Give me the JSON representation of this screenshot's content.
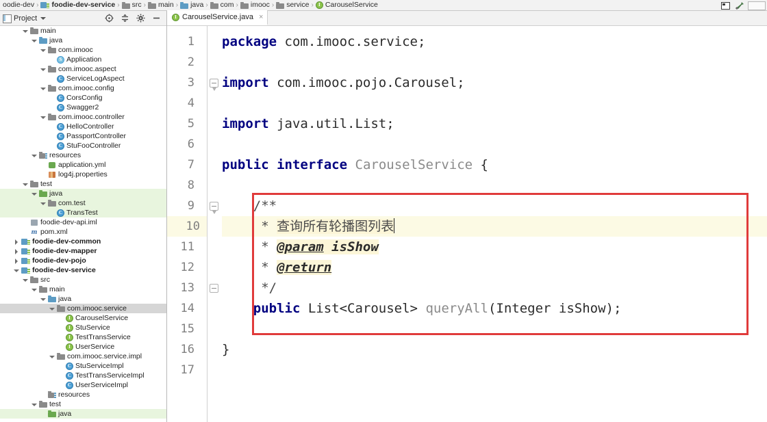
{
  "navbar": {
    "crumbs": [
      {
        "label": "oodie-dev",
        "icon": "none",
        "bold": false
      },
      {
        "label": "foodie-dev-service",
        "icon": "module-icon",
        "bold": true
      },
      {
        "label": "src",
        "icon": "folder-icon",
        "bold": false
      },
      {
        "label": "main",
        "icon": "folder-icon",
        "bold": false
      },
      {
        "label": "java",
        "icon": "source-folder-icon",
        "bold": false
      },
      {
        "label": "com",
        "icon": "folder-icon",
        "bold": false
      },
      {
        "label": "imooc",
        "icon": "folder-icon",
        "bold": false
      },
      {
        "label": "service",
        "icon": "folder-icon",
        "bold": false
      },
      {
        "label": "CarouselService",
        "icon": "interface-icon",
        "bold": false
      }
    ],
    "separator": "›",
    "right_icons": [
      "layout-window-icon",
      "build-hammer-icon"
    ]
  },
  "project_panel": {
    "title": "Project",
    "toolbar_icons": [
      "locate-target-icon",
      "collapse-all-icon",
      "settings-gear-icon",
      "hide-minimize-icon"
    ],
    "tree": [
      {
        "label": "main",
        "indent": 2,
        "icon": "folder-icon",
        "arrow": "down",
        "bold": false,
        "state": "normal"
      },
      {
        "label": "java",
        "indent": 3,
        "icon": "source-folder-icon",
        "arrow": "down",
        "bold": false,
        "state": "normal"
      },
      {
        "label": "com.imooc",
        "indent": 4,
        "icon": "folder-icon",
        "arrow": "down",
        "bold": false,
        "state": "normal"
      },
      {
        "label": "Application",
        "indent": 5,
        "icon": "spring-class-icon",
        "arrow": "none",
        "bold": false,
        "state": "normal"
      },
      {
        "label": "com.imooc.aspect",
        "indent": 4,
        "icon": "folder-icon",
        "arrow": "down",
        "bold": false,
        "state": "normal"
      },
      {
        "label": "ServiceLogAspect",
        "indent": 5,
        "icon": "class-icon",
        "arrow": "none",
        "bold": false,
        "state": "normal"
      },
      {
        "label": "com.imooc.config",
        "indent": 4,
        "icon": "folder-icon",
        "arrow": "down",
        "bold": false,
        "state": "normal"
      },
      {
        "label": "CorsConfig",
        "indent": 5,
        "icon": "class-icon",
        "arrow": "none",
        "bold": false,
        "state": "normal"
      },
      {
        "label": "Swagger2",
        "indent": 5,
        "icon": "class-icon",
        "arrow": "none",
        "bold": false,
        "state": "normal"
      },
      {
        "label": "com.imooc.controller",
        "indent": 4,
        "icon": "folder-icon",
        "arrow": "down",
        "bold": false,
        "state": "normal"
      },
      {
        "label": "HelloController",
        "indent": 5,
        "icon": "class-icon",
        "arrow": "none",
        "bold": false,
        "state": "normal"
      },
      {
        "label": "PassportController",
        "indent": 5,
        "icon": "class-icon",
        "arrow": "none",
        "bold": false,
        "state": "normal"
      },
      {
        "label": "StuFooController",
        "indent": 5,
        "icon": "class-icon",
        "arrow": "none",
        "bold": false,
        "state": "normal"
      },
      {
        "label": "resources",
        "indent": 3,
        "icon": "resources-folder-icon",
        "arrow": "down",
        "bold": false,
        "state": "normal"
      },
      {
        "label": "application.yml",
        "indent": 4,
        "icon": "yaml-file-icon",
        "arrow": "none",
        "bold": false,
        "state": "normal"
      },
      {
        "label": "log4j.properties",
        "indent": 4,
        "icon": "properties-file-icon",
        "arrow": "none",
        "bold": false,
        "state": "normal"
      },
      {
        "label": "test",
        "indent": 2,
        "icon": "folder-icon",
        "arrow": "down",
        "bold": false,
        "state": "normal"
      },
      {
        "label": "java",
        "indent": 3,
        "icon": "test-source-folder-icon",
        "arrow": "down",
        "bold": false,
        "state": "testsrc"
      },
      {
        "label": "com.test",
        "indent": 4,
        "icon": "folder-icon",
        "arrow": "down",
        "bold": false,
        "state": "testsrc"
      },
      {
        "label": "TransTest",
        "indent": 5,
        "icon": "class-icon",
        "arrow": "none",
        "bold": false,
        "state": "testsrc"
      },
      {
        "label": "foodie-dev-api.iml",
        "indent": 2,
        "icon": "iml-file-icon",
        "arrow": "none",
        "bold": false,
        "state": "normal"
      },
      {
        "label": "pom.xml",
        "indent": 2,
        "icon": "maven-file-icon",
        "arrow": "none",
        "bold": false,
        "state": "normal"
      },
      {
        "label": "foodie-dev-common",
        "indent": 1,
        "icon": "module-icon",
        "arrow": "right",
        "bold": true,
        "state": "normal"
      },
      {
        "label": "foodie-dev-mapper",
        "indent": 1,
        "icon": "module-icon",
        "arrow": "right",
        "bold": true,
        "state": "normal"
      },
      {
        "label": "foodie-dev-pojo",
        "indent": 1,
        "icon": "module-icon",
        "arrow": "right",
        "bold": true,
        "state": "normal"
      },
      {
        "label": "foodie-dev-service",
        "indent": 1,
        "icon": "module-icon",
        "arrow": "down",
        "bold": true,
        "state": "normal"
      },
      {
        "label": "src",
        "indent": 2,
        "icon": "folder-icon",
        "arrow": "down",
        "bold": false,
        "state": "normal"
      },
      {
        "label": "main",
        "indent": 3,
        "icon": "folder-icon",
        "arrow": "down",
        "bold": false,
        "state": "normal"
      },
      {
        "label": "java",
        "indent": 4,
        "icon": "source-folder-icon",
        "arrow": "down",
        "bold": false,
        "state": "normal"
      },
      {
        "label": "com.imooc.service",
        "indent": 5,
        "icon": "folder-icon",
        "arrow": "down",
        "bold": false,
        "state": "selected"
      },
      {
        "label": "CarouselService",
        "indent": 6,
        "icon": "interface-icon",
        "arrow": "none",
        "bold": false,
        "state": "normal"
      },
      {
        "label": "StuService",
        "indent": 6,
        "icon": "interface-icon",
        "arrow": "none",
        "bold": false,
        "state": "normal"
      },
      {
        "label": "TestTransService",
        "indent": 6,
        "icon": "interface-icon",
        "arrow": "none",
        "bold": false,
        "state": "normal"
      },
      {
        "label": "UserService",
        "indent": 6,
        "icon": "interface-icon",
        "arrow": "none",
        "bold": false,
        "state": "normal"
      },
      {
        "label": "com.imooc.service.impl",
        "indent": 5,
        "icon": "folder-icon",
        "arrow": "down",
        "bold": false,
        "state": "normal"
      },
      {
        "label": "StuServiceImpl",
        "indent": 6,
        "icon": "class-icon",
        "arrow": "none",
        "bold": false,
        "state": "normal"
      },
      {
        "label": "TestTransServiceImpl",
        "indent": 6,
        "icon": "class-icon",
        "arrow": "none",
        "bold": false,
        "state": "normal"
      },
      {
        "label": "UserServiceImpl",
        "indent": 6,
        "icon": "class-icon",
        "arrow": "none",
        "bold": false,
        "state": "normal"
      },
      {
        "label": "resources",
        "indent": 4,
        "icon": "resources-folder-icon",
        "arrow": "none",
        "bold": false,
        "state": "normal"
      },
      {
        "label": "test",
        "indent": 3,
        "icon": "folder-icon",
        "arrow": "down",
        "bold": false,
        "state": "normal"
      },
      {
        "label": "java",
        "indent": 4,
        "icon": "test-source-folder-icon",
        "arrow": "none",
        "bold": false,
        "state": "testsrc"
      }
    ]
  },
  "editor": {
    "tabs": [
      {
        "label": "CarouselService.java",
        "icon": "interface-icon",
        "close": "×",
        "active": true
      }
    ],
    "current_line": 10,
    "lines": [
      {
        "n": 1,
        "tokens": [
          {
            "t": "package",
            "c": "kw"
          },
          {
            "t": " com.imooc.service;",
            "c": "plain"
          }
        ]
      },
      {
        "n": 2,
        "tokens": []
      },
      {
        "n": 3,
        "tokens": [
          {
            "t": "import",
            "c": "kw"
          },
          {
            "t": " com.imooc.pojo.Carousel;",
            "c": "plain"
          }
        ]
      },
      {
        "n": 4,
        "tokens": []
      },
      {
        "n": 5,
        "tokens": [
          {
            "t": "import",
            "c": "kw"
          },
          {
            "t": " java.util.List;",
            "c": "plain"
          }
        ]
      },
      {
        "n": 6,
        "tokens": []
      },
      {
        "n": 7,
        "tokens": [
          {
            "t": "public",
            "c": "kw"
          },
          {
            "t": " ",
            "c": "plain"
          },
          {
            "t": "interface",
            "c": "kw"
          },
          {
            "t": " ",
            "c": "plain"
          },
          {
            "t": "CarouselService",
            "c": "mname"
          },
          {
            "t": " {",
            "c": "plain"
          }
        ]
      },
      {
        "n": 8,
        "tokens": []
      },
      {
        "n": 9,
        "tokens": [
          {
            "t": "    ",
            "c": "plain"
          },
          {
            "t": "/**",
            "c": "cmt"
          }
        ]
      },
      {
        "n": 10,
        "tokens": [
          {
            "t": "     * ",
            "c": "cmt"
          },
          {
            "t": "查询所有轮播图列表",
            "c": "cmt-hl"
          },
          {
            "t": "|",
            "c": "caret"
          }
        ]
      },
      {
        "n": 11,
        "tokens": [
          {
            "t": "     * ",
            "c": "cmt"
          },
          {
            "t": "@param",
            "c": "tag-hl"
          },
          {
            "t": " ",
            "c": "cmt-hl"
          },
          {
            "t": "isShow",
            "c": "tagval-hl"
          }
        ]
      },
      {
        "n": 12,
        "tokens": [
          {
            "t": "     * ",
            "c": "cmt"
          },
          {
            "t": "@return",
            "c": "tag-hl"
          }
        ]
      },
      {
        "n": 13,
        "tokens": [
          {
            "t": "     */",
            "c": "cmt"
          }
        ]
      },
      {
        "n": 14,
        "tokens": [
          {
            "t": "    ",
            "c": "plain"
          },
          {
            "t": "public",
            "c": "kw"
          },
          {
            "t": " List<Carousel> ",
            "c": "type"
          },
          {
            "t": "queryAll",
            "c": "mname"
          },
          {
            "t": "(Integer isShow);",
            "c": "type"
          }
        ]
      },
      {
        "n": 15,
        "tokens": []
      },
      {
        "n": 16,
        "tokens": [
          {
            "t": "}",
            "c": "plain"
          }
        ]
      },
      {
        "n": 17,
        "tokens": []
      }
    ]
  },
  "annotation": {
    "type": "red-rectangle-highlight",
    "color": "#e03b3b",
    "covers_lines": "9-15"
  }
}
